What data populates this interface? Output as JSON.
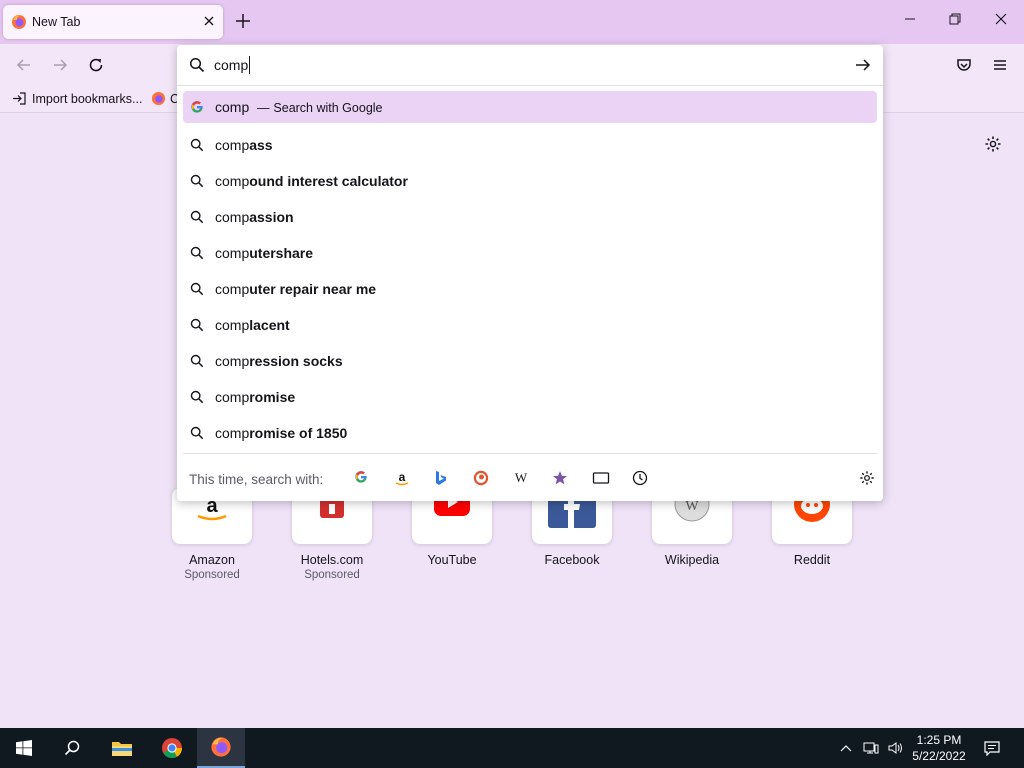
{
  "tab": {
    "title": "New Tab"
  },
  "urlbar": {
    "value": "comp",
    "results": [
      {
        "typed": "comp",
        "separator": "—",
        "action": "Search with Google",
        "icon": "google-icon",
        "selected": true
      },
      {
        "typed": "comp",
        "completion": "ass"
      },
      {
        "typed": "comp",
        "completion": "ound interest calculator"
      },
      {
        "typed": "comp",
        "completion": "assion"
      },
      {
        "typed": "comp",
        "completion": "utershare"
      },
      {
        "typed": "comp",
        "completion": "uter repair near me"
      },
      {
        "typed": "comp",
        "completion": "lacent"
      },
      {
        "typed": "comp",
        "completion": "ression socks"
      },
      {
        "typed": "comp",
        "completion": "romise"
      },
      {
        "typed": "comp",
        "completion": "romise of 1850"
      }
    ],
    "oneoff_label": "This time, search with:",
    "oneoff_engines": [
      "google-icon",
      "amazon-icon",
      "bing-icon",
      "duckduckgo-icon",
      "wikipedia-icon",
      "bookmarks-star-icon",
      "tabs-icon",
      "history-clock-icon"
    ]
  },
  "bookmarks": {
    "import_label": "Import bookmarks...",
    "second_label": "C"
  },
  "top_sites": [
    {
      "label": "Amazon",
      "sub": "Sponsored",
      "icon": "amazon-logo-icon"
    },
    {
      "label": "Hotels.com",
      "sub": "Sponsored",
      "icon": "hotels-logo-icon"
    },
    {
      "label": "YouTube",
      "sub": "",
      "icon": "youtube-logo-icon"
    },
    {
      "label": "Facebook",
      "sub": "",
      "icon": "facebook-logo-icon"
    },
    {
      "label": "Wikipedia",
      "sub": "",
      "icon": "wikipedia-logo-icon"
    },
    {
      "label": "Reddit",
      "sub": "",
      "icon": "reddit-logo-icon"
    }
  ],
  "taskbar": {
    "time": "1:25 PM",
    "date": "5/22/2022"
  },
  "colors": {
    "tabbar": "#e6c7f2",
    "page": "#f0e3f8",
    "selected_row": "#ead3f5",
    "taskbar": "#101820"
  }
}
